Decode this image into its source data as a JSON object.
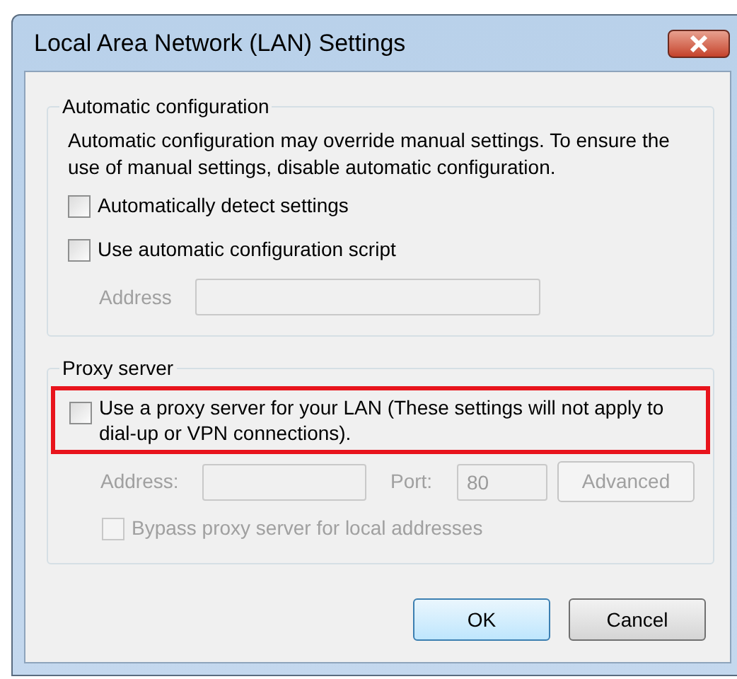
{
  "window": {
    "title": "Local Area Network (LAN) Settings"
  },
  "automatic_configuration": {
    "title": "Automatic configuration",
    "description": "Automatic configuration may override manual settings.  To ensure the use of manual settings, disable automatic configuration.",
    "checkboxes": [
      {
        "label": "Automatically detect settings",
        "checked": false
      },
      {
        "label": "Use automatic configuration script",
        "checked": false
      }
    ],
    "address": {
      "label": "Address",
      "disabled": true
    }
  },
  "proxy_server": {
    "title": "Proxy server",
    "use_proxy": {
      "label": "Use a proxy server for your LAN (These settings will not apply to dial-up or VPN connections).",
      "checked": false,
      "highlighted": true
    },
    "address": {
      "label": "Address:",
      "disabled": true
    },
    "port": {
      "label": "Port:",
      "value": "80",
      "disabled": true
    },
    "advanced_button": {
      "label": "Advanced",
      "disabled": true
    },
    "bypass": {
      "label": "Bypass proxy server for local addresses",
      "checked": false,
      "disabled": true
    }
  },
  "buttons": [
    {
      "label": "OK",
      "default": true
    },
    {
      "label": "Cancel",
      "default": false
    }
  ]
}
